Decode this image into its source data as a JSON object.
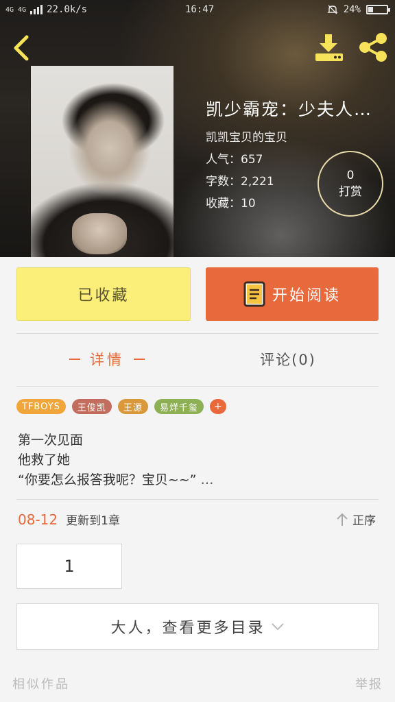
{
  "status_bar": {
    "network": "4G 4G",
    "speed": "22.0k/s",
    "time": "16:47",
    "battery": "24%",
    "battery_level": 0.24
  },
  "header": {
    "back_icon": "chevron-left-icon",
    "download_icon": "download-icon",
    "share_icon": "share-icon",
    "title": "凯少霸宠：少夫人…",
    "author": "凯凯宝贝的宝贝",
    "popularity": "人气：657",
    "word_count": "字数：2,221",
    "favorites": "收藏：10",
    "tip_count": "0",
    "tip_label": "打赏"
  },
  "actions": {
    "collected_label": "已收藏",
    "read_label": "开始阅读",
    "read_icon": "book-icon"
  },
  "tabs": {
    "detail": "详情",
    "comments": "评论(0)"
  },
  "tags": [
    {
      "label": "TFBOYS",
      "color": "#f0a63b"
    },
    {
      "label": "王俊凯",
      "color": "#c26d5e"
    },
    {
      "label": "王源",
      "color": "#d9993a"
    },
    {
      "label": "易烊千玺",
      "color": "#8eb055"
    }
  ],
  "tag_more": "+",
  "synopsis": {
    "line1": "第一次见面",
    "line2": "他救了她",
    "line3": "“你要怎么报答我呢？宝贝~~”",
    "ellipsis": "…"
  },
  "update": {
    "date": "08-12",
    "text": "更新到1章",
    "sort_label": "正序",
    "sort_icon": "arrow-up-icon"
  },
  "chapters": [
    "1"
  ],
  "more_catalog": "大人，查看更多目录",
  "footer": {
    "similar": "相似作品",
    "report": "举报"
  },
  "colors": {
    "accent": "#e8693b",
    "collect_bg": "#fbef7a",
    "icon_yellow": "#f7e35a"
  }
}
